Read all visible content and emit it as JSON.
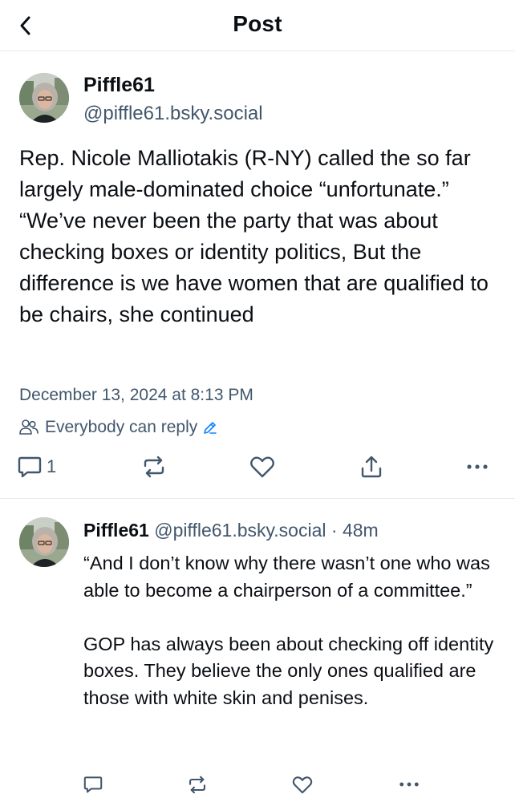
{
  "header": {
    "title": "Post",
    "back_icon": "chevron-left-icon"
  },
  "post": {
    "author_name": "Piffle61",
    "author_handle": "@piffle61.bsky.social",
    "text": "Rep. Nicole Malliotakis (R-NY) called the so far largely male-dominated choice “unfortunate.” “We’ve never been the party that was about checking boxes or identity politics, But the difference is we have women that are qualified to be chairs, she continued",
    "date": "December 13, 2024 at 8:13 PM",
    "reply_setting": "Everybody can reply",
    "reply_count": "1"
  },
  "reply": {
    "author_name": "Piffle61",
    "author_handle": "@piffle61.bsky.social",
    "separator": "·",
    "time": "48m",
    "paragraph1": "“And I don’t know why there wasn’t one who was able to become a chairperson of a committee.”",
    "paragraph2": "GOP has always been about checking off identity boxes. They believe the only ones qualified are those with white skin and penises."
  },
  "colors": {
    "text": "#0b0f14",
    "secondary_text": "#42576c",
    "accent": "#1083fe",
    "divider": "#e6e9ee"
  }
}
